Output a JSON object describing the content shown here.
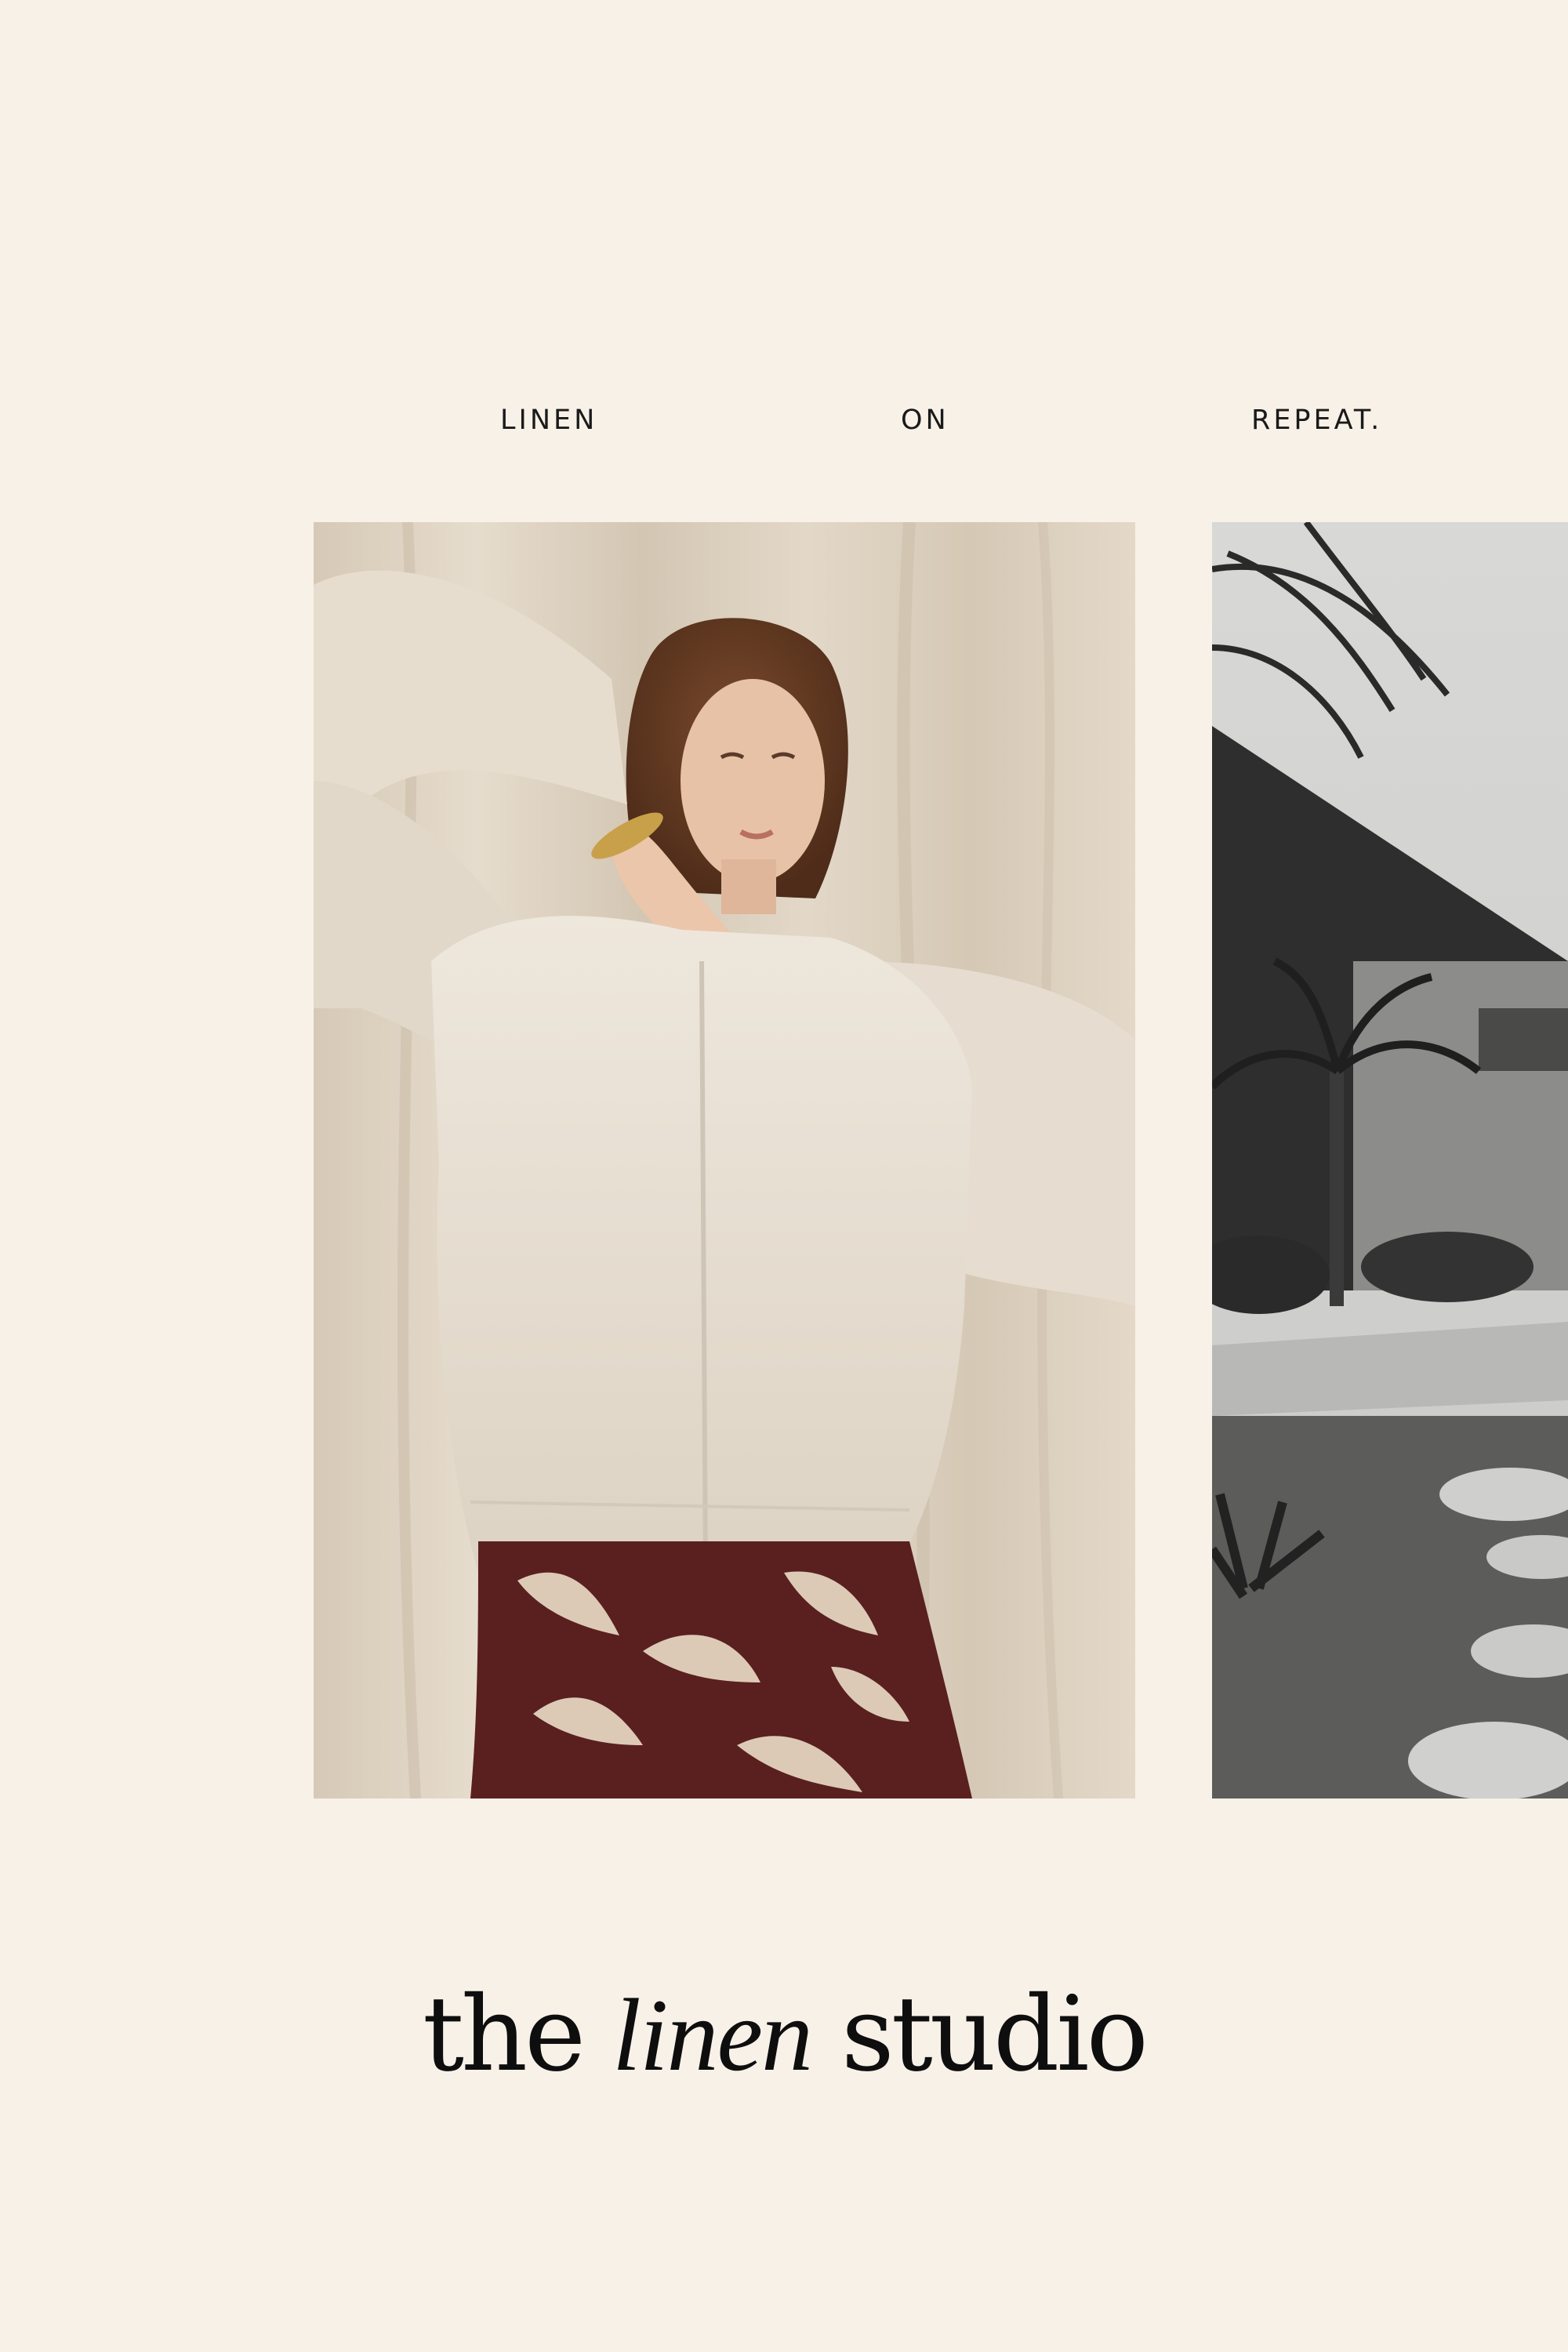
{
  "tagline": [
    "LINEN",
    "ON",
    "REPEAT."
  ],
  "logo": {
    "part1": "the",
    "part2": "linen",
    "part3": "studio"
  },
  "images": {
    "left": "model in oversized beige linen zip jacket and burgundy palm-print skirt",
    "right": "black and white photo of palm trees, desert garden and stepping stones"
  },
  "colors": {
    "background": "#f8f1e8",
    "text": "#141414",
    "skirt": "#5a1f1f"
  }
}
